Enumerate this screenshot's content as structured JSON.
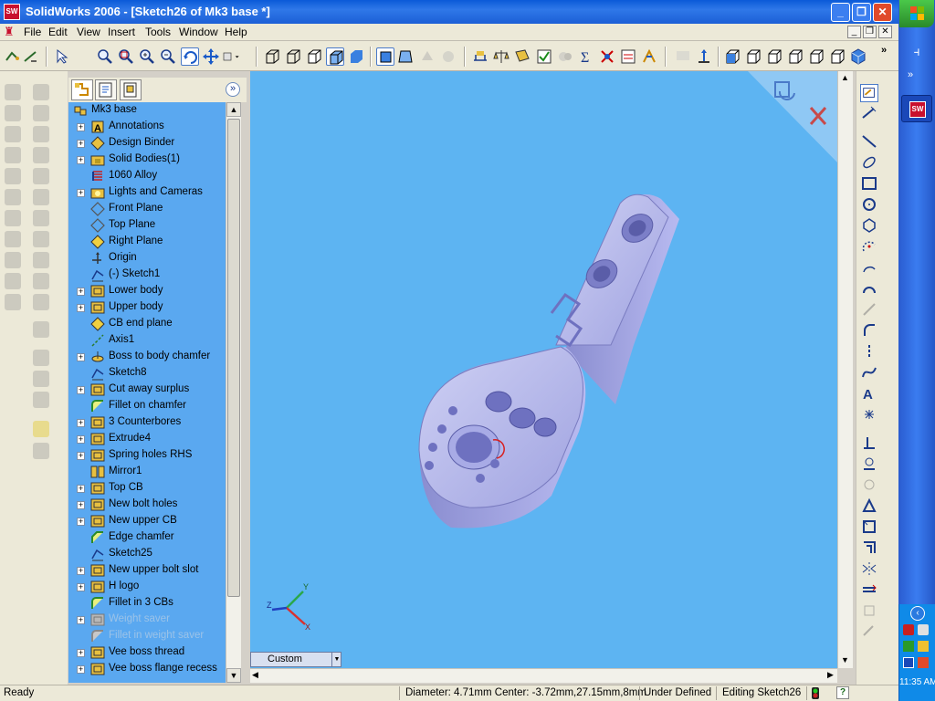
{
  "window": {
    "title": "SolidWorks 2006 - [Sketch26 of Mk3 base *]",
    "app_icon_text": "SW"
  },
  "menu": [
    "File",
    "Edit",
    "View",
    "Insert",
    "Tools",
    "Window",
    "Help"
  ],
  "feature_tree": {
    "root": "Mk3 base",
    "items": [
      {
        "label": "Annotations",
        "icon": "annotations-icon",
        "expandable": true
      },
      {
        "label": "Design Binder",
        "icon": "design-binder-icon",
        "expandable": true
      },
      {
        "label": "Solid Bodies(1)",
        "icon": "solid-bodies-folder-icon",
        "expandable": true
      },
      {
        "label": "1060 Alloy",
        "icon": "material-icon",
        "expandable": false
      },
      {
        "label": "Lights and Cameras",
        "icon": "lights-folder-icon",
        "expandable": true
      },
      {
        "label": "Front Plane",
        "icon": "plane-icon",
        "expandable": false
      },
      {
        "label": "Top Plane",
        "icon": "plane-icon",
        "expandable": false
      },
      {
        "label": "Right Plane",
        "icon": "plane-selected-icon",
        "expandable": false
      },
      {
        "label": "Origin",
        "icon": "origin-icon",
        "expandable": false
      },
      {
        "label": "(-) Sketch1",
        "icon": "sketch-icon",
        "expandable": false
      },
      {
        "label": "Lower body",
        "icon": "extrude-icon",
        "expandable": true
      },
      {
        "label": "Upper body",
        "icon": "extrude-icon",
        "expandable": true
      },
      {
        "label": "CB end plane",
        "icon": "plane-selected-icon",
        "expandable": false
      },
      {
        "label": "Axis1",
        "icon": "axis-icon",
        "expandable": false
      },
      {
        "label": "Boss to body chamfer",
        "icon": "revolve-icon",
        "expandable": true
      },
      {
        "label": "Sketch8",
        "icon": "sketch-icon",
        "expandable": false
      },
      {
        "label": "Cut away surplus",
        "icon": "extrude-icon",
        "expandable": true
      },
      {
        "label": "Fillet on chamfer",
        "icon": "fillet-icon",
        "expandable": false
      },
      {
        "label": "3 Counterbores",
        "icon": "extrude-icon",
        "expandable": true
      },
      {
        "label": "Extrude4",
        "icon": "extrude-icon",
        "expandable": true
      },
      {
        "label": "Spring holes RHS",
        "icon": "extrude-icon",
        "expandable": true
      },
      {
        "label": "Mirror1",
        "icon": "mirror-icon",
        "expandable": false
      },
      {
        "label": "Top CB",
        "icon": "extrude-icon",
        "expandable": true
      },
      {
        "label": "New bolt holes",
        "icon": "extrude-icon",
        "expandable": true
      },
      {
        "label": "New upper CB",
        "icon": "extrude-icon",
        "expandable": true
      },
      {
        "label": "Edge chamfer",
        "icon": "chamfer-icon",
        "expandable": false
      },
      {
        "label": "Sketch25",
        "icon": "sketch-icon",
        "expandable": false
      },
      {
        "label": "New upper bolt slot",
        "icon": "extrude-icon",
        "expandable": true
      },
      {
        "label": "H logo",
        "icon": "extrude-icon",
        "expandable": true
      },
      {
        "label": "Fillet in 3 CBs",
        "icon": "fillet-icon",
        "expandable": false
      },
      {
        "label": "Weight saver",
        "icon": "extrude-suppressed-icon",
        "expandable": true,
        "suppressed": true
      },
      {
        "label": "Fillet in weight saver",
        "icon": "fillet-suppressed-icon",
        "expandable": false,
        "suppressed": true
      },
      {
        "label": "Vee boss thread",
        "icon": "extrude-icon",
        "expandable": true
      },
      {
        "label": "Vee boss flange recess",
        "icon": "extrude-icon",
        "expandable": true
      }
    ]
  },
  "view_selector": {
    "value": "Custom"
  },
  "triad": {
    "x": "X",
    "y": "Y",
    "z": "Z"
  },
  "status": {
    "ready": "Ready",
    "measure": "Diameter: 4.71mm  Center: -3.72mm,27.15mm,8mm",
    "definition": "Under Defined",
    "editing": "Editing Sketch26",
    "help": "?"
  },
  "taskbar": {
    "clock": "11:35 AM"
  },
  "colors": {
    "graphics_bg": "#5db4f2",
    "tree_bg": "#5aa8f0",
    "part": "#a6a8e8",
    "title_blue": "#0a5ad8"
  }
}
